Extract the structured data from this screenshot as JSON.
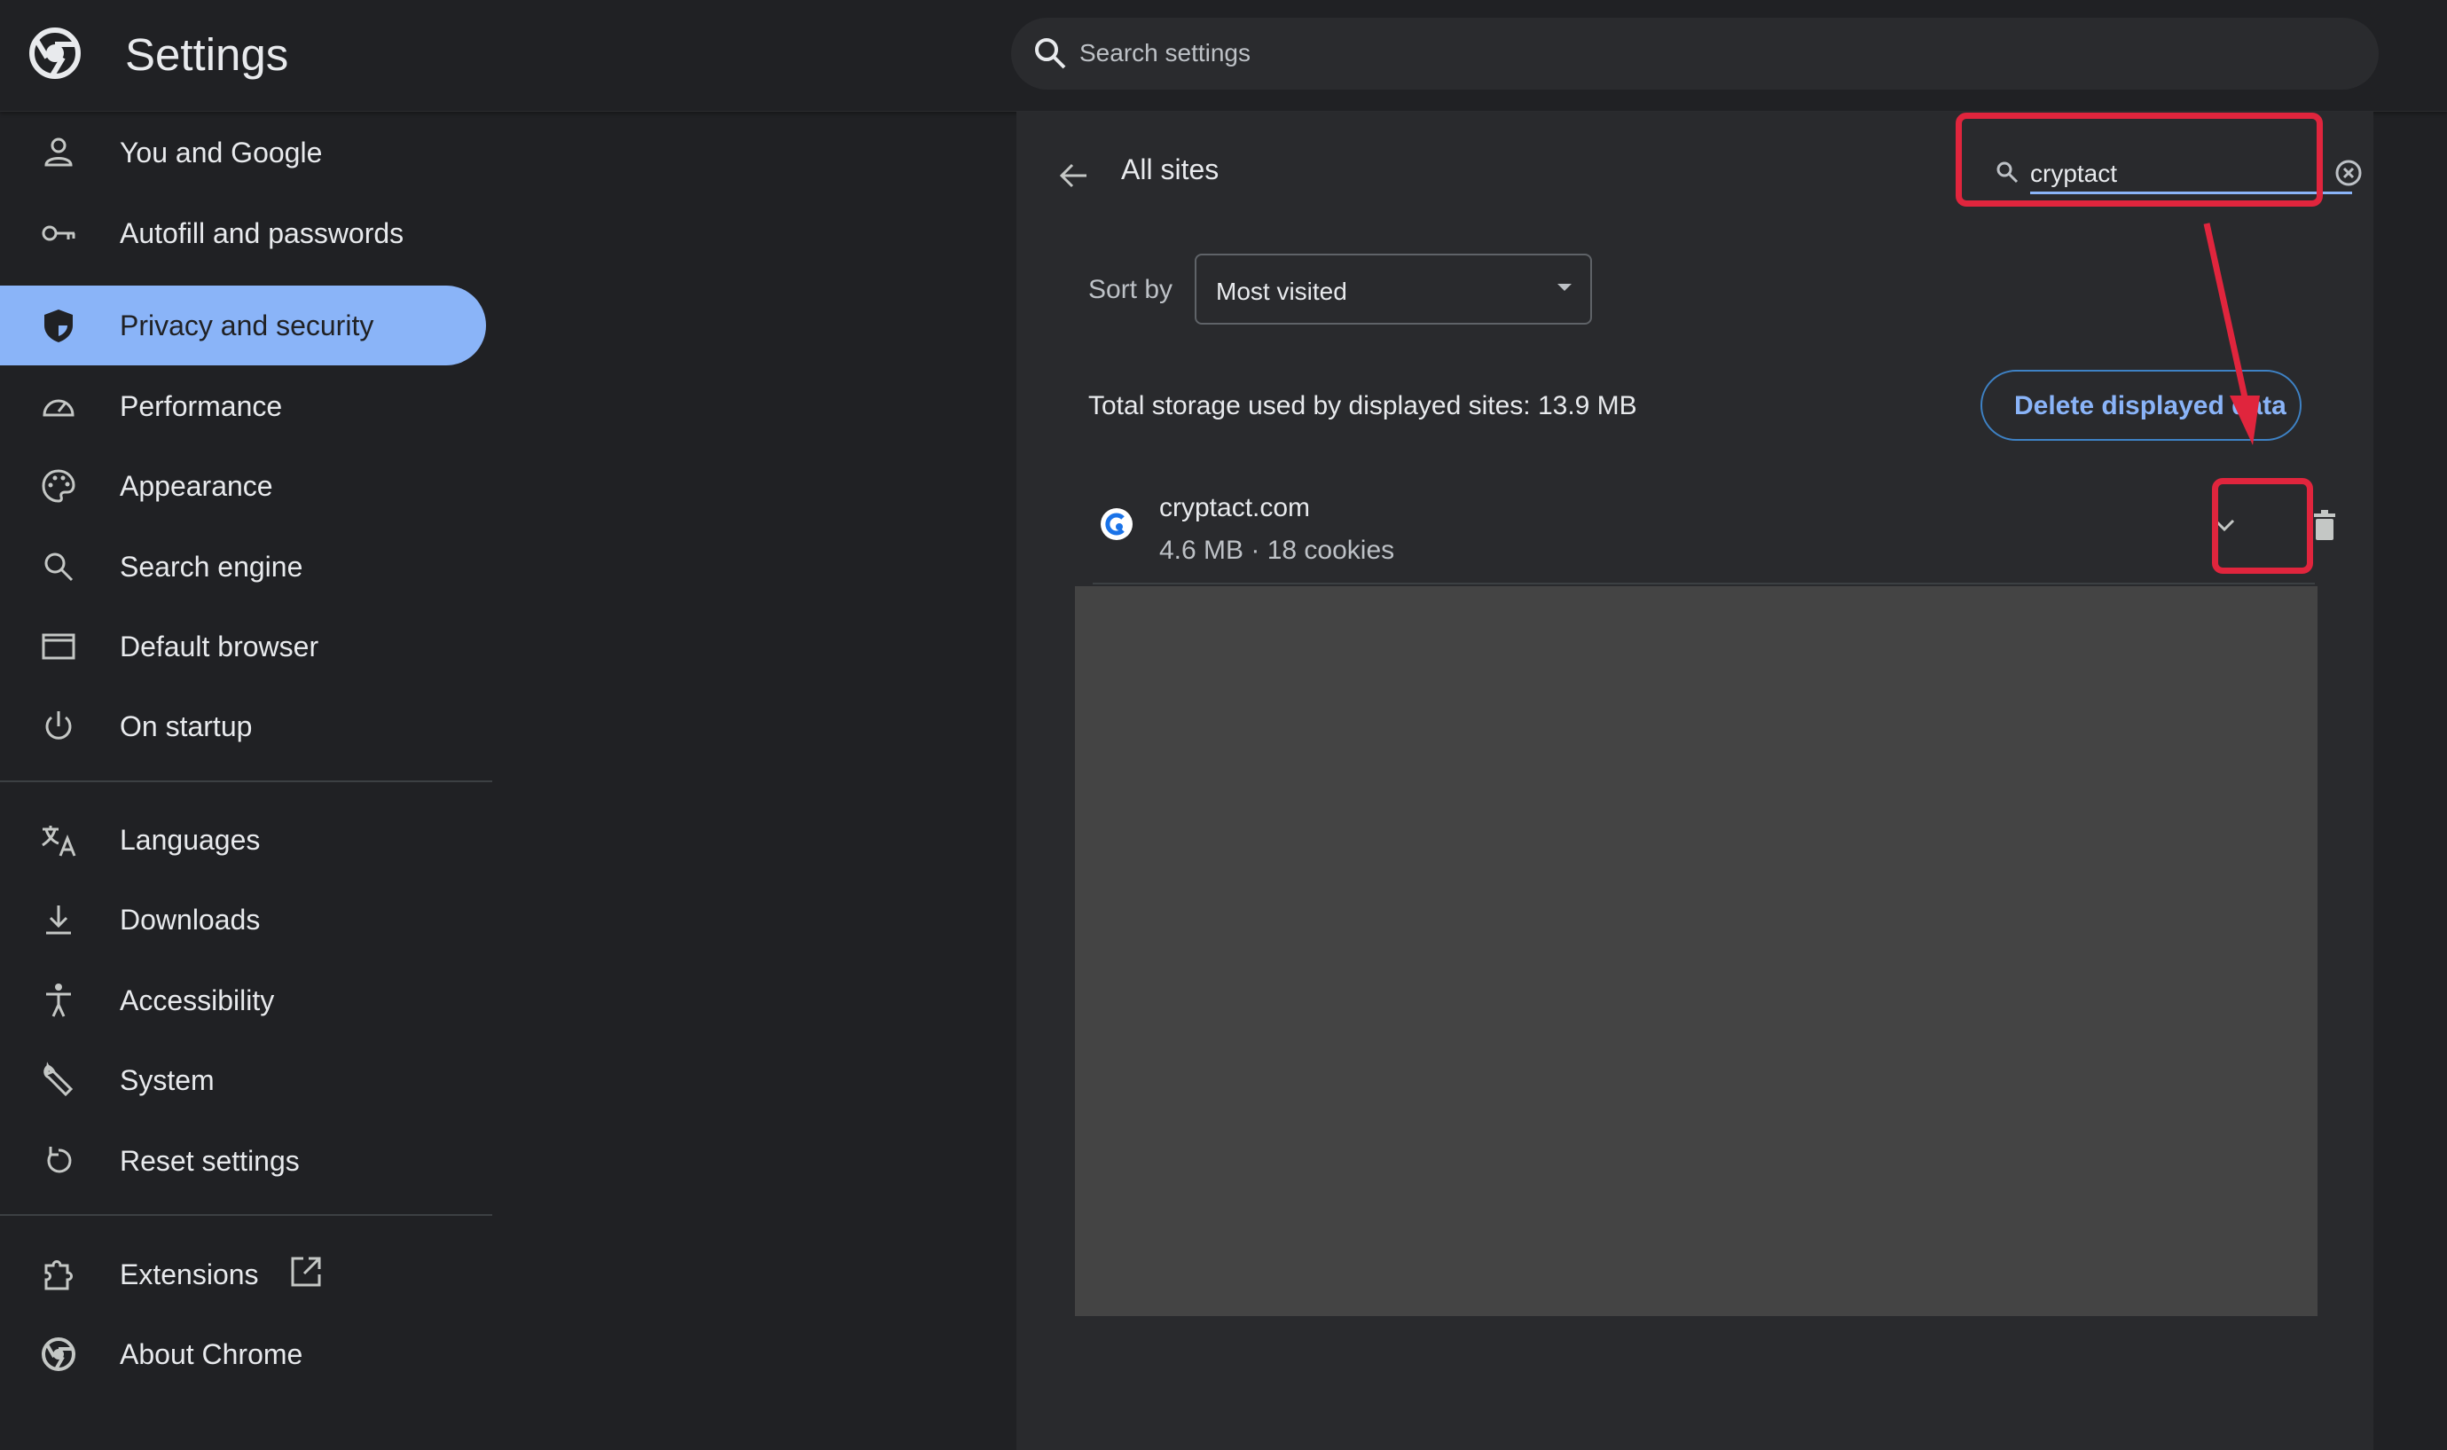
{
  "header": {
    "title": "Settings",
    "search_placeholder": "Search settings"
  },
  "sidebar": {
    "items": [
      {
        "label": "You and Google",
        "icon": "person-icon"
      },
      {
        "label": "Autofill and passwords",
        "icon": "key-icon"
      },
      {
        "label": "Privacy and security",
        "icon": "shield-icon",
        "active": true
      },
      {
        "label": "Performance",
        "icon": "speedometer-icon"
      },
      {
        "label": "Appearance",
        "icon": "palette-icon"
      },
      {
        "label": "Search engine",
        "icon": "search-icon"
      },
      {
        "label": "Default browser",
        "icon": "browser-window-icon"
      },
      {
        "label": "On startup",
        "icon": "power-icon"
      },
      {
        "label": "Languages",
        "icon": "translate-icon"
      },
      {
        "label": "Downloads",
        "icon": "download-icon"
      },
      {
        "label": "Accessibility",
        "icon": "accessibility-icon"
      },
      {
        "label": "System",
        "icon": "wrench-icon"
      },
      {
        "label": "Reset settings",
        "icon": "reset-icon"
      },
      {
        "label": "Extensions",
        "icon": "puzzle-icon"
      },
      {
        "label": "About Chrome",
        "icon": "chrome-icon"
      }
    ]
  },
  "main": {
    "title": "All sites",
    "site_search_value": "cryptact",
    "sort_label": "Sort by",
    "sort_value": "Most visited",
    "storage_text": "Total storage used by displayed sites: 13.9 MB",
    "delete_button": "Delete displayed data",
    "site": {
      "name": "cryptact.com",
      "meta": "4.6 MB · 18 cookies"
    }
  },
  "colors": {
    "accent": "#8ab4f8",
    "highlight": "#e0253d",
    "background": "#202124",
    "panel": "#292a2d"
  }
}
